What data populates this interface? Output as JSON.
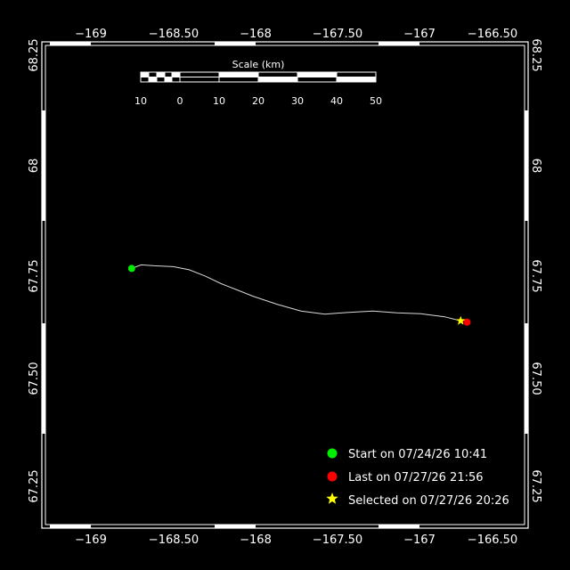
{
  "map": {
    "x_ticks": [
      "−169",
      "−168.50",
      "−168",
      "−167.50",
      "−167",
      "−166.50"
    ],
    "y_ticks": [
      "68.25",
      "68",
      "67.75",
      "67.50",
      "67.25"
    ],
    "x_range": [
      -169.3,
      -166.3
    ],
    "y_range": [
      67.18,
      68.25
    ],
    "colors": {
      "background": "#000000",
      "frame": "#ffffff",
      "track": "#d9d9d9",
      "start": "#00ee00",
      "last": "#ff0000",
      "selected": "#ffff00"
    }
  },
  "scale_bar": {
    "title": "Scale (km)",
    "labels": [
      "10",
      "0",
      "10",
      "20",
      "30",
      "40",
      "50"
    ]
  },
  "track": {
    "points": [
      [
        -168.76,
        67.752
      ],
      [
        -168.7,
        67.76
      ],
      [
        -168.62,
        67.758
      ],
      [
        -168.5,
        67.756
      ],
      [
        -168.4,
        67.749
      ],
      [
        -168.3,
        67.735
      ],
      [
        -168.2,
        67.718
      ],
      [
        -168.1,
        67.704
      ],
      [
        -168.0,
        67.69
      ],
      [
        -167.85,
        67.672
      ],
      [
        -167.7,
        67.657
      ],
      [
        -167.55,
        67.65
      ],
      [
        -167.4,
        67.654
      ],
      [
        -167.25,
        67.657
      ],
      [
        -167.1,
        67.653
      ],
      [
        -166.95,
        67.651
      ],
      [
        -166.8,
        67.644
      ],
      [
        -166.7,
        67.635
      ]
    ],
    "start": [
      -168.76,
      67.752
    ],
    "last": [
      -166.66,
      67.632
    ],
    "selected": [
      -166.7,
      67.635
    ]
  },
  "legend": {
    "start": "Start on 07/24/26 10:41",
    "last": "Last on 07/27/26 21:56",
    "selected": "Selected on 07/27/26 20:26"
  }
}
